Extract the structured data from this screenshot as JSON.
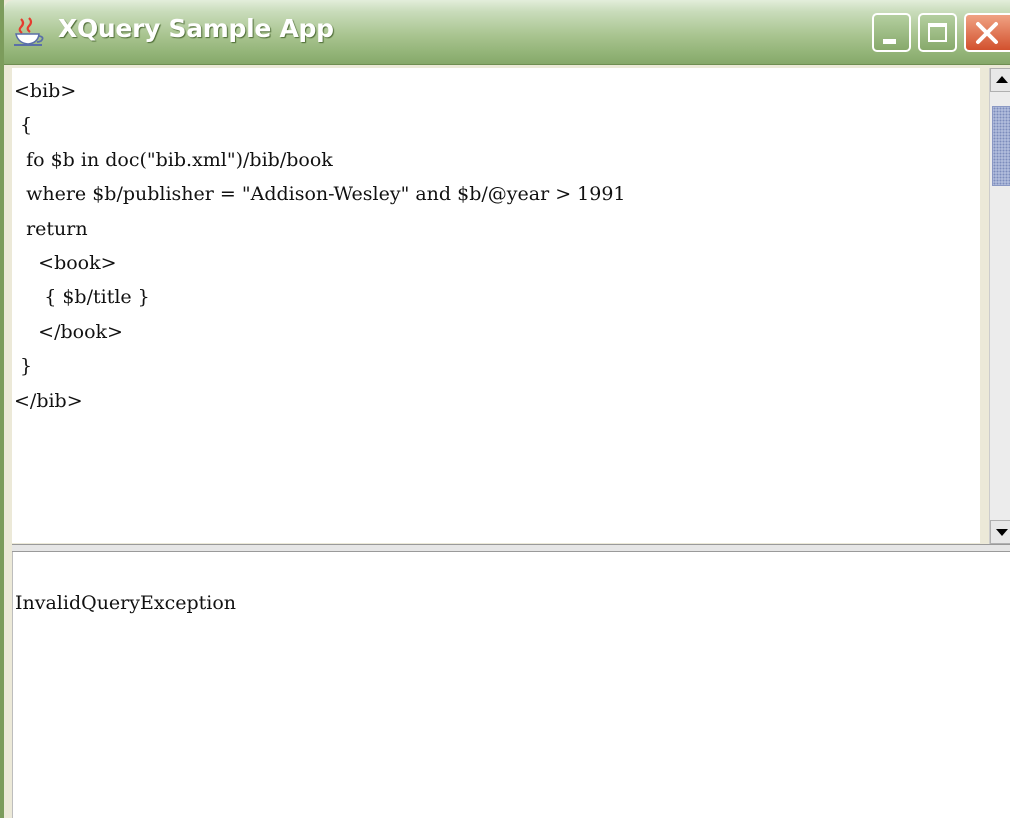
{
  "window": {
    "title": "XQuery Sample App",
    "icon": "java-cup-icon",
    "controls": [
      "minimize-icon",
      "maximize-icon",
      "close-icon"
    ]
  },
  "editor": {
    "lines": [
      "<bib>",
      " {",
      "  fo $b in doc(\"bib.xml\")/bib/book",
      "  where $b/publisher = \"Addison-Wesley\" and $b/@year > 1991",
      "  return",
      "    <book>",
      "     { $b/title }",
      "    </book>",
      " }",
      "</bib>"
    ]
  },
  "output": {
    "text": "InvalidQueryException"
  },
  "colors": {
    "titlebar": "#93b478",
    "close_button": "#d2512e",
    "scroll_thumb": "#b8c3e0"
  }
}
